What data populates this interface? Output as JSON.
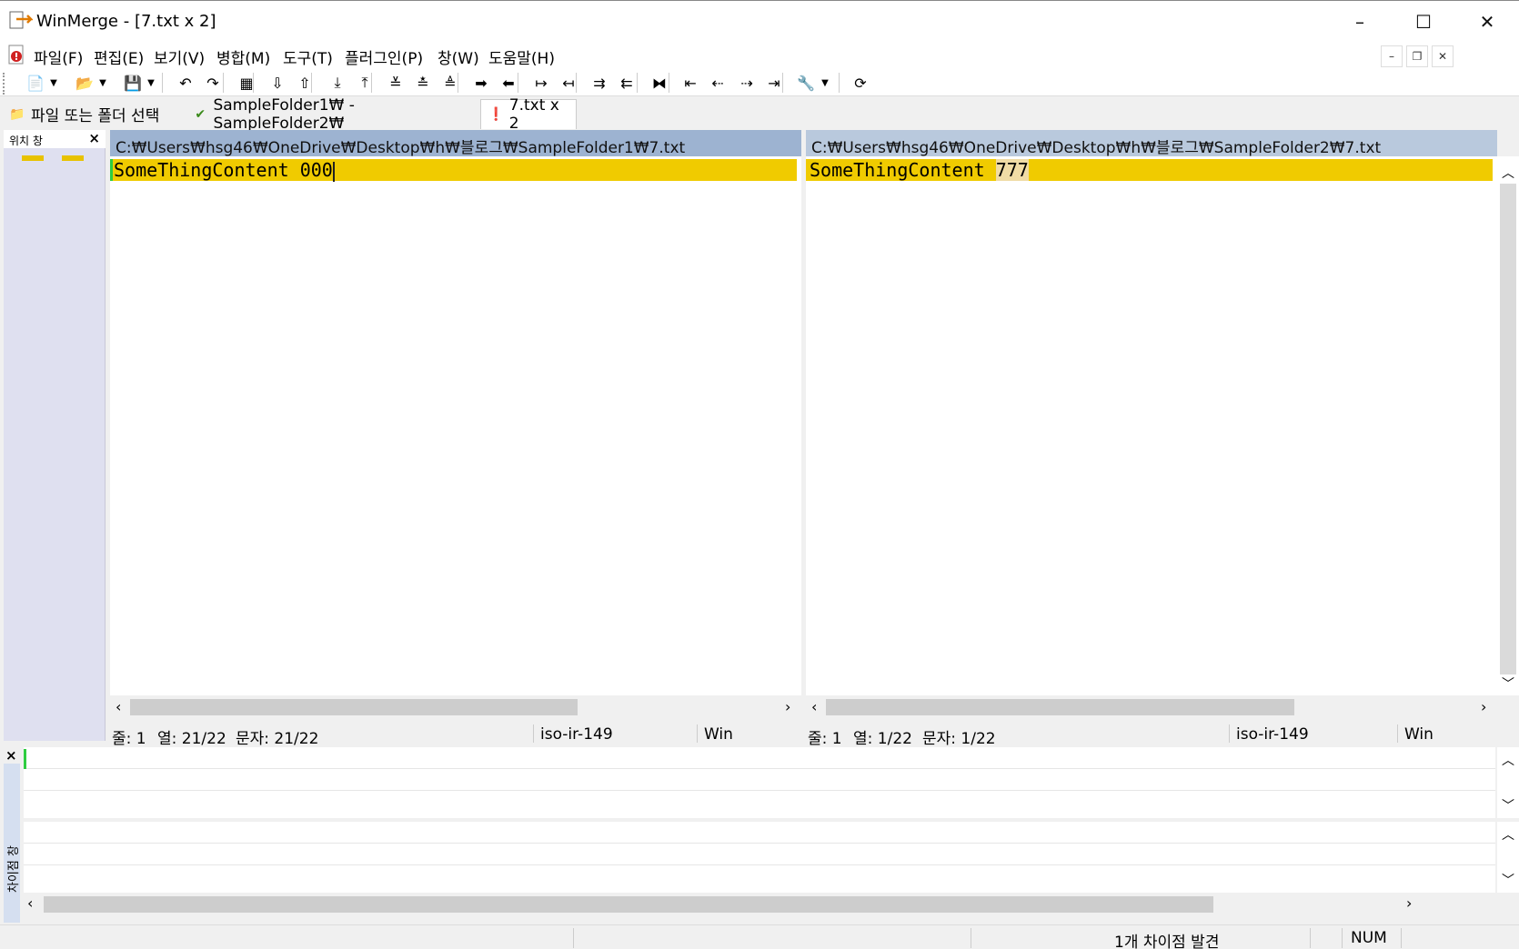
{
  "window": {
    "title": "WinMerge - [7.txt x 2]",
    "minimize": "–",
    "maximize": "☐",
    "close": "✕"
  },
  "menu": [
    {
      "label": "파일(F)"
    },
    {
      "label": "편집(E)"
    },
    {
      "label": "보기(V)"
    },
    {
      "label": "병합(M)"
    },
    {
      "label": "도구(T)"
    },
    {
      "label": "플러그인(P)"
    },
    {
      "label": "창(W)"
    },
    {
      "label": "도움말(H)"
    }
  ],
  "mdi_controls": {
    "minimize": "–",
    "restore": "❐",
    "close": "✕"
  },
  "toolbar": [
    {
      "name": "new-icon",
      "glyph": "📄"
    },
    {
      "name": "new-dropdown-icon",
      "glyph": "▼"
    },
    {
      "name": "open-icon",
      "glyph": "📂"
    },
    {
      "name": "open-dropdown-icon",
      "glyph": "▼"
    },
    {
      "name": "save-icon",
      "glyph": "💾"
    },
    {
      "name": "save-dropdown-icon",
      "glyph": "▼"
    },
    {
      "name": "undo-icon",
      "glyph": "↶"
    },
    {
      "name": "redo-icon",
      "glyph": "↷"
    },
    {
      "name": "filmstrip-icon",
      "glyph": "▦"
    },
    {
      "name": "next-diff-icon",
      "glyph": "⇩"
    },
    {
      "name": "prev-diff-icon",
      "glyph": "⇧"
    },
    {
      "name": "last-diff-icon",
      "glyph": "⤓"
    },
    {
      "name": "first-diff-icon",
      "glyph": "⤒"
    },
    {
      "name": "current-diff-icon",
      "glyph": "≚"
    },
    {
      "name": "next-conflict-icon",
      "glyph": "≛"
    },
    {
      "name": "prev-conflict-icon",
      "glyph": "≜"
    },
    {
      "name": "copy-right-icon",
      "glyph": "➡"
    },
    {
      "name": "copy-left-icon",
      "glyph": "⬅"
    },
    {
      "name": "copy-right-advance-icon",
      "glyph": "↦"
    },
    {
      "name": "copy-left-advance-icon",
      "glyph": "↤"
    },
    {
      "name": "copy-all-right-icon",
      "glyph": "⇉"
    },
    {
      "name": "copy-all-left-icon",
      "glyph": "⇇"
    },
    {
      "name": "split-icon",
      "glyph": "⧓"
    },
    {
      "name": "left-pane-icon",
      "glyph": "⇤"
    },
    {
      "name": "left-pane-alt-icon",
      "glyph": "⇠"
    },
    {
      "name": "right-pane-icon",
      "glyph": "⇢"
    },
    {
      "name": "right-pane-alt-icon",
      "glyph": "⇥"
    },
    {
      "name": "options-icon",
      "glyph": "🔧"
    },
    {
      "name": "options-dropdown-icon",
      "glyph": "▼"
    },
    {
      "name": "refresh-icon",
      "glyph": "⟳"
    }
  ],
  "tabs": [
    {
      "label": "파일 또는 폴더 선택",
      "icon": "folder-select-icon",
      "glyph": "📁"
    },
    {
      "label": "SampleFolder1₩ - SampleFolder2₩",
      "icon": "check-icon",
      "glyph": "✔"
    },
    {
      "label": "7.txt x 2",
      "icon": "file-diff-icon",
      "glyph": "❗"
    }
  ],
  "location_pane": {
    "title": "위치 창",
    "close": "×"
  },
  "left": {
    "path": "C:₩Users₩hsg46₩OneDrive₩Desktop₩h₩블로그₩SampleFolder1₩7.txt",
    "text_common": "SomeThingContent ",
    "text_diff": "000",
    "status": {
      "line": "줄: 1",
      "col": "열: 21/22",
      "char": "문자: 21/22",
      "encoding": "iso-ir-149",
      "eol": "Win"
    }
  },
  "right": {
    "path": "C:₩Users₩hsg46₩OneDrive₩Desktop₩h₩블로그₩SampleFolder2₩7.txt",
    "text_common": "SomeThingContent ",
    "text_diff": "777",
    "status": {
      "line": "줄: 1",
      "col": "열: 1/22",
      "char": "문자: 1/22",
      "encoding": "iso-ir-149",
      "eol": "Win"
    }
  },
  "diff_pane": {
    "title": "차이점 창",
    "close": "×"
  },
  "statusbar": {
    "message": "1개 차이점 발견",
    "num": "NUM"
  },
  "colors": {
    "diff_line": "#f0cb00",
    "diff_word": "#f0dca6",
    "left_header": "#9db3d1",
    "right_header": "#b9c9dd"
  }
}
